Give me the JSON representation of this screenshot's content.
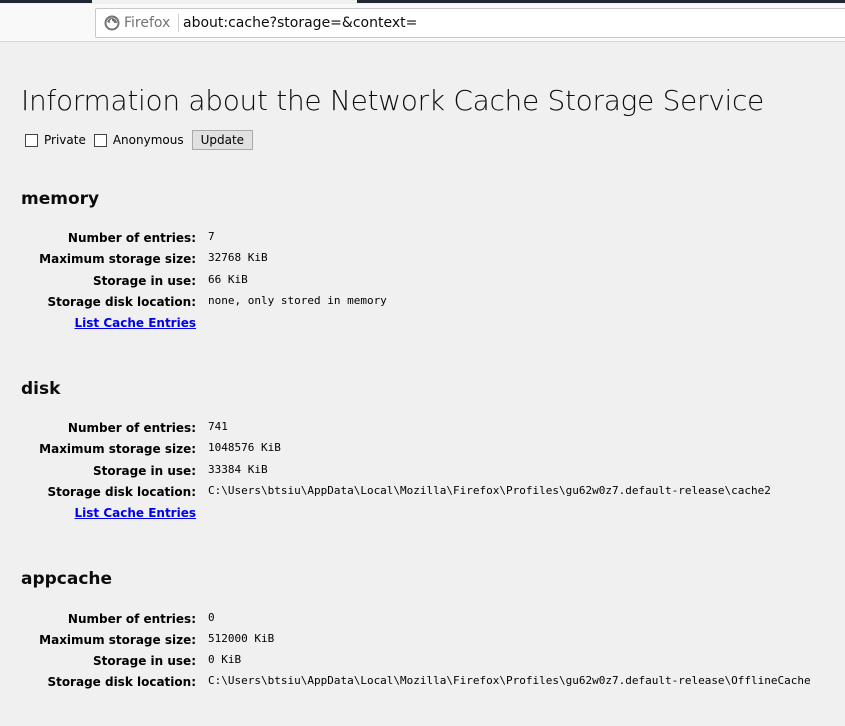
{
  "browser": {
    "identity_label": "Firefox",
    "url": "about:cache?storage=&context="
  },
  "page": {
    "title": "Information about the Network Cache Storage Service",
    "options": {
      "private_label": "Private",
      "anonymous_label": "Anonymous",
      "update_label": "Update"
    },
    "labels": {
      "entries": "Number of entries:",
      "max_size": "Maximum storage size:",
      "in_use": "Storage in use:",
      "location": "Storage disk location:",
      "list_link": "List Cache Entries"
    },
    "sections": [
      {
        "name": "memory",
        "entries": "7",
        "max_size": "32768 KiB",
        "in_use": "66 KiB",
        "location": "none, only stored in memory"
      },
      {
        "name": "disk",
        "entries": "741",
        "max_size": "1048576 KiB",
        "in_use": "33384 KiB",
        "location": "C:\\Users\\btsiu\\AppData\\Local\\Mozilla\\Firefox\\Profiles\\gu62w0z7.default-release\\cache2"
      },
      {
        "name": "appcache",
        "entries": "0",
        "max_size": "512000 KiB",
        "in_use": "0 KiB",
        "location": "C:\\Users\\btsiu\\AppData\\Local\\Mozilla\\Firefox\\Profiles\\gu62w0z7.default-release\\OfflineCache"
      }
    ]
  },
  "colors": {
    "page_bg": "#f0f0f0",
    "link": "#0000ee",
    "identity_gray": "#737373"
  },
  "icons": {
    "identity": "firefox-logo-icon"
  }
}
